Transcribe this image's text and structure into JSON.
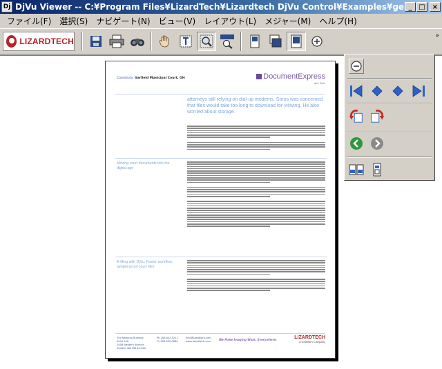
{
  "window": {
    "title": "DjVu Viewer -- C:¥Program Files¥LizardTech¥Lizardtech DjVu Control¥Examples¥general.djvu",
    "icon_label": "Dj",
    "controls": {
      "minimize": "_",
      "maximize": "□",
      "close": "×"
    }
  },
  "menu": [
    "ファイル(F)",
    "選択(S)",
    "ナビゲート(N)",
    "ビュー(V)",
    "レイアウト(L)",
    "メジャー(M)",
    "ヘルプ(H)"
  ],
  "toolbar": {
    "logo_text": "LIZARDTECH",
    "buttons": [
      "save-icon",
      "print-icon",
      "find-icon",
      "hand-tool-icon",
      "text-select-icon",
      "zoom-tool-icon",
      "region-zoom-icon",
      "single-page-icon",
      "continuous-page-icon",
      "fit-page-icon",
      "zoom-in-icon"
    ],
    "pressed": [
      "zoom-tool-icon",
      "fit-page-icon"
    ],
    "overflow": "»"
  },
  "document": {
    "case_study_label": "Casestudy:",
    "case_study_name": "Garfield Municipal Court, OH",
    "brand": "DocumentExpress",
    "brand_sub": "with DjVu",
    "headline": "attorneys still relying on dial-up modems, Soros was concerned that files would take too long to download for viewing. He also worried about storage.",
    "section_2_heading": "Moving court documents into the digital age",
    "section_3_heading": "E-filing with DjVu: Faster workflow, tamper-proof court files",
    "footer_address": [
      "The National Building",
      "Suite 200",
      "1008 Western Avenue",
      "Seattle, WA 98104 USA"
    ],
    "footer_phone": [
      "Ph 206.652.5211",
      "Fx 206.652.0880"
    ],
    "footer_web": [
      "info@lizardtech.com",
      "www.lizardtech.com"
    ],
    "footer_tagline": "We Make Imaging Work. Everywhere.",
    "footer_brand": "LIZARDTECH",
    "footer_brand_sub": "a Celartem Company"
  },
  "palette": {
    "rows": [
      [
        "zoom-out-icon"
      ],
      [
        "first-page-icon",
        "previous-page-icon",
        "next-page-icon",
        "last-page-icon"
      ],
      [
        "rotate-left-icon",
        "rotate-right-icon"
      ],
      [
        "back-icon",
        "forward-icon"
      ],
      [
        "thumbnails-icon",
        "page-info-icon"
      ]
    ],
    "colors": {
      "nav_blue": "#2a63c8",
      "rotate_red": "#c8281e",
      "back_green": "#2a9a3a",
      "disabled_gray": "#8a8a8a"
    }
  }
}
